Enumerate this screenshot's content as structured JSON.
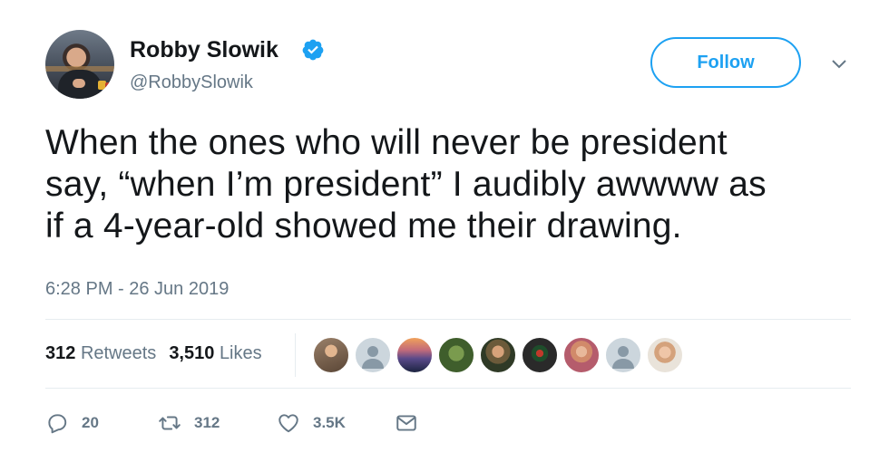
{
  "author": {
    "name": "Robby Slowik",
    "handle": "@RobbySlowik",
    "verified_icon": "verified-badge-icon"
  },
  "follow_button": {
    "label": "Follow"
  },
  "tweet": {
    "line1": "When the ones who will never be president",
    "line2": "say, “when I’m president” I audibly awwww as",
    "line3": "if a 4-year-old showed me their drawing.",
    "timestamp": "6:28 PM - 26 Jun 2019"
  },
  "stats": {
    "retweets_count": "312",
    "retweets_label": "Retweets",
    "likes_count": "3,510",
    "likes_label": "Likes"
  },
  "actions": {
    "reply_count": "20",
    "retweet_count": "312",
    "like_count": "3.5K"
  },
  "colors": {
    "accent": "#1da1f2",
    "secondary_text": "#657786",
    "primary_text": "#14171a",
    "divider": "#e6ecf0"
  }
}
